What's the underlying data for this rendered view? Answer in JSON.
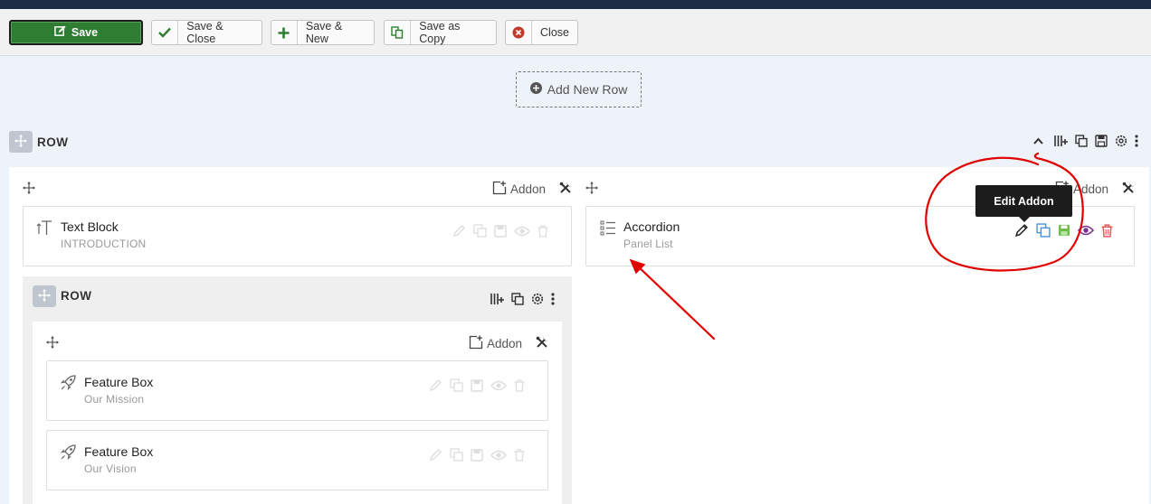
{
  "toolbar": {
    "save": "Save",
    "save_close": "Save & Close",
    "save_new": "Save & New",
    "save_copy": "Save as Copy",
    "close": "Close"
  },
  "builder": {
    "add_new_row": "Add New Row",
    "row_label": "ROW",
    "addon_label": "Addon",
    "tooltip": "Edit Addon"
  },
  "addons": {
    "text_block": {
      "title": "Text Block",
      "subtitle": "INTRODUCTION"
    },
    "accordion": {
      "title": "Accordion",
      "subtitle": "Panel List"
    },
    "feature_1": {
      "title": "Feature Box",
      "subtitle": "Our Mission"
    },
    "feature_2": {
      "title": "Feature Box",
      "subtitle": "Our Vision"
    }
  },
  "colors": {
    "save_green": "#2f7d32",
    "annotation_red": "#e00000",
    "tooltip_bg": "#1c1c1c",
    "duplicate_blue": "#4a90d9",
    "save_icon_green": "#6cc04a",
    "visibility_purple": "#7b2d8e",
    "delete_red": "#e05a5a"
  }
}
